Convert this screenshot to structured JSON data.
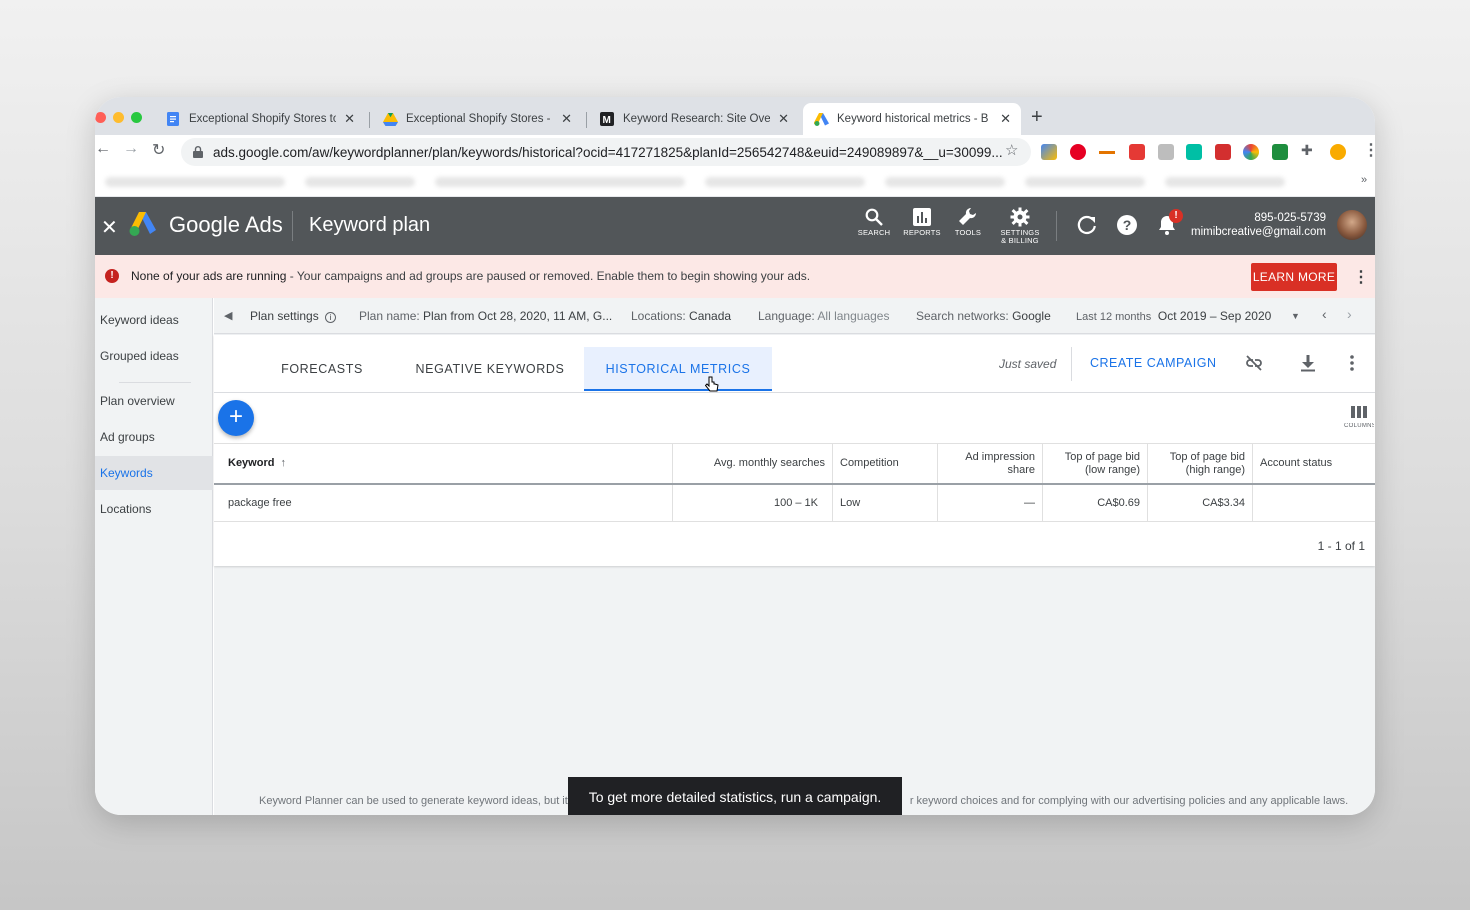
{
  "browser": {
    "tabs": [
      {
        "title": "Exceptional Shopify Stores to I",
        "icon": "docs-icon"
      },
      {
        "title": "Exceptional Shopify Stores - G",
        "icon": "drive-icon"
      },
      {
        "title": "Keyword Research: Site Overvi",
        "icon": "moz-icon"
      },
      {
        "title": "Keyword historical metrics - B",
        "icon": "google-ads-icon"
      }
    ],
    "url": "ads.google.com/aw/keywordplanner/plan/keywords/historical?ocid=417271825&planId=256542748&euid=249089897&__u=30099..."
  },
  "header": {
    "brand": "Google Ads",
    "page_title": "Keyword plan",
    "tools": [
      {
        "label": "SEARCH",
        "icon": "search-icon"
      },
      {
        "label": "REPORTS",
        "icon": "reports-icon"
      },
      {
        "label": "TOOLS",
        "icon": "wrench-icon"
      },
      {
        "label": "SETTINGS & BILLING",
        "icon": "gear-icon"
      }
    ],
    "notification_badge": "!",
    "phone": "895-025-5739",
    "email": "mimibcreative@gmail.com"
  },
  "alert": {
    "bold": "None of your ads are running",
    "text": " - Your campaigns and ad groups are paused or removed. Enable them to begin showing your ads.",
    "button": "LEARN MORE"
  },
  "sidebar": {
    "items": [
      {
        "label": "Keyword ideas"
      },
      {
        "label": "Grouped ideas"
      },
      {
        "label": "Plan overview"
      },
      {
        "label": "Ad groups"
      },
      {
        "label": "Keywords"
      },
      {
        "label": "Locations"
      }
    ]
  },
  "plan_bar": {
    "settings": "Plan settings",
    "plan_name_label": "Plan name:",
    "plan_name": "Plan from Oct 28, 2020, 11 AM, G...",
    "locations_label": "Locations:",
    "locations": "Canada",
    "language_label": "Language:",
    "language": "All languages",
    "networks_label": "Search networks:",
    "networks": "Google",
    "range_label": "Last 12 months",
    "range": "Oct 2019 – Sep 2020"
  },
  "tabs": [
    "FORECASTS",
    "NEGATIVE KEYWORDS",
    "HISTORICAL METRICS"
  ],
  "actions": {
    "status": "Just saved",
    "create": "CREATE CAMPAIGN",
    "columns_label": "COLUMNS"
  },
  "table": {
    "headers": [
      "Keyword",
      "Avg. monthly searches",
      "Competition",
      "Ad impression share",
      "Top of page bid (low range)",
      "Top of page bid (high range)",
      "Account status"
    ],
    "rows": [
      [
        "package free",
        "100 – 1K",
        "Low",
        "—",
        "CA$0.69",
        "CA$3.34",
        ""
      ]
    ],
    "pagination": "1 - 1 of 1"
  },
  "footer": {
    "note_left": "Keyword Planner can be used to generate keyword ideas, but it",
    "note_right": "r keyword choices and for complying with our advertising policies and any applicable laws."
  },
  "tooltip": "To get more detailed statistics, run a campaign.",
  "colors": {
    "accent": "#1a73e8",
    "header_bg": "#525659",
    "alert_bg": "#fce8e6",
    "danger": "#d93025"
  }
}
